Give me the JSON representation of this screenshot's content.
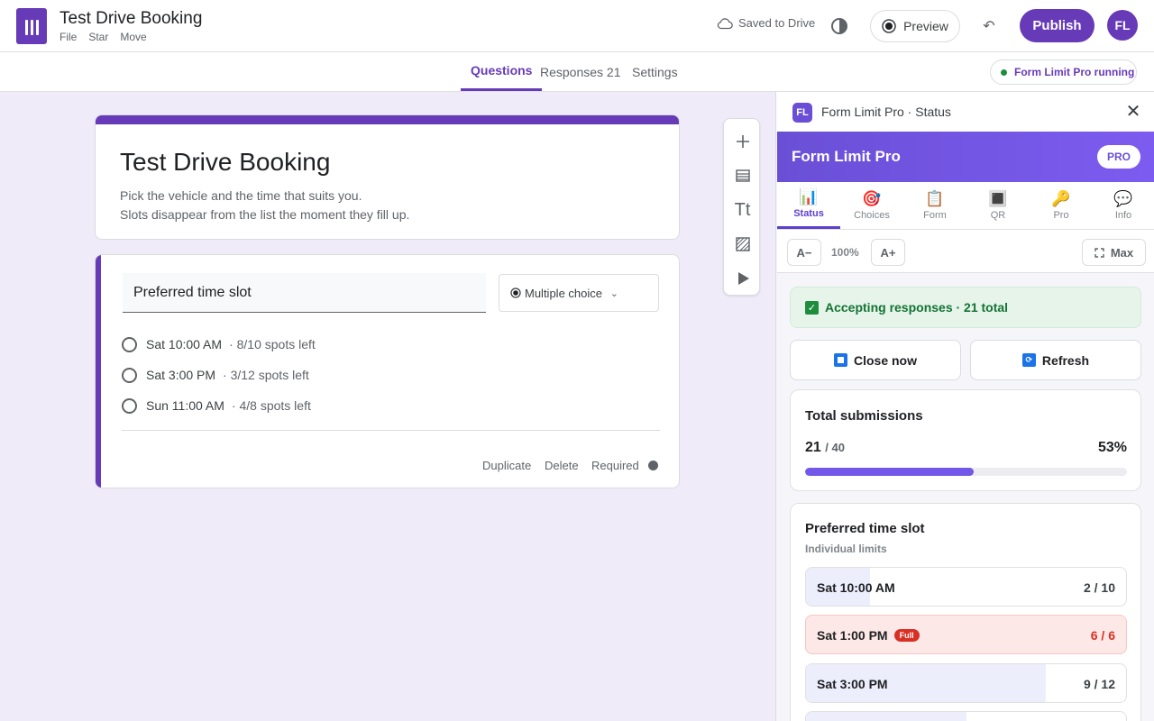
{
  "header": {
    "title": "Test Drive Booking",
    "menu": [
      "File",
      "Star",
      "Move"
    ],
    "saved_status": "Saved to Drive",
    "preview_label": "Preview",
    "publish_label": "Publish",
    "avatar_initials": "FL"
  },
  "tabs": {
    "questions": "Questions",
    "responses": "Responses 21",
    "settings": "Settings",
    "extension_status": "Form Limit Pro running"
  },
  "form": {
    "title": "Test Drive Booking",
    "description_line1": "Pick the vehicle and the time that suits you.",
    "description_line2": "Slots disappear from the list the moment they fill up.",
    "question": {
      "title": "Preferred time slot",
      "type": "Multiple choice",
      "options": [
        {
          "label": "Sat 10:00 AM",
          "spots": "· 8/10 spots left"
        },
        {
          "label": "Sat 3:00 PM",
          "spots": "· 3/12 spots left"
        },
        {
          "label": "Sun 11:00 AM",
          "spots": "· 4/8 spots left"
        }
      ],
      "footer": {
        "duplicate": "Duplicate",
        "delete": "Delete",
        "required": "Required"
      }
    }
  },
  "toolbar": {
    "icons": [
      "add-question-icon",
      "import-questions-icon",
      "add-title-icon",
      "add-image-icon",
      "add-video-icon"
    ],
    "title_glyph": "Tt"
  },
  "panel": {
    "badge": "FL",
    "header_title": "Form Limit Pro · Status",
    "brand_name": "Form Limit Pro",
    "pro_badge": "PRO",
    "tabs": [
      {
        "label": "Status",
        "icon": "📊"
      },
      {
        "label": "Choices",
        "icon": "🎯"
      },
      {
        "label": "Form",
        "icon": "📋"
      },
      {
        "label": "QR",
        "icon": "🔳"
      },
      {
        "label": "Pro",
        "icon": "🔑"
      },
      {
        "label": "Info",
        "icon": "💬"
      }
    ],
    "zoom": {
      "decrease": "A−",
      "level": "100%",
      "increase": "A+",
      "max": "Max"
    },
    "accepting_banner": "Accepting responses · 21 total",
    "close_now_label": "Close now",
    "refresh_label": "Refresh",
    "submissions": {
      "title": "Total submissions",
      "count": "21",
      "limit": "/ 40",
      "percent_label": "53%",
      "progress": 0.525
    },
    "slots": {
      "title": "Preferred time slot",
      "subtitle": "Individual limits",
      "full_label": "Full",
      "rows": [
        {
          "label": "Sat 10:00 AM",
          "count": "2 / 10",
          "fill": 0.2,
          "full": false
        },
        {
          "label": "Sat 1:00 PM",
          "count": "6 / 6",
          "fill": 1.0,
          "full": true
        },
        {
          "label": "Sat 3:00 PM",
          "count": "9 / 12",
          "fill": 0.75,
          "full": false
        }
      ]
    }
  },
  "colors": {
    "brand": "#673ab7",
    "extension_accent": "#6a4fd6",
    "success": "#1e8e3e",
    "danger": "#d93025"
  }
}
